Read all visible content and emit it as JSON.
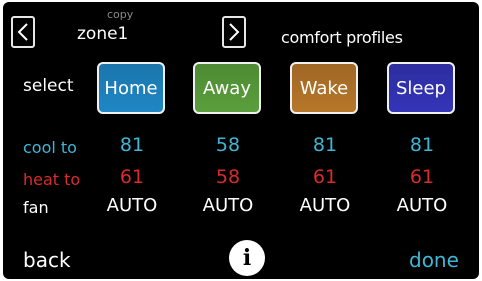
{
  "header": {
    "copy_label": "copy",
    "zone_name": "zone1",
    "title": "comfort profiles",
    "prev_icon": "chevron-left-icon",
    "next_icon": "chevron-right-icon"
  },
  "select_label": "select",
  "profiles": [
    {
      "name": "Home",
      "color": "#1f87c5",
      "cool_to": "81",
      "heat_to": "61",
      "fan": "AUTO"
    },
    {
      "name": "Away",
      "color": "#5a9f3c",
      "cool_to": "58",
      "heat_to": "58",
      "fan": "AUTO"
    },
    {
      "name": "Wake",
      "color": "#b7772a",
      "cool_to": "81",
      "heat_to": "61",
      "fan": "AUTO"
    },
    {
      "name": "Sleep",
      "color": "#3434b8",
      "cool_to": "81",
      "heat_to": "61",
      "fan": "AUTO"
    }
  ],
  "rows": {
    "cool_label": "cool to",
    "heat_label": "heat to",
    "fan_label": "fan"
  },
  "colors": {
    "cool": "#3fb6d6",
    "heat": "#d92b2b",
    "text": "#ffffff",
    "background": "#000000"
  },
  "footer": {
    "back_label": "back",
    "info_label": "i",
    "info_icon": "info-icon",
    "done_label": "done"
  }
}
